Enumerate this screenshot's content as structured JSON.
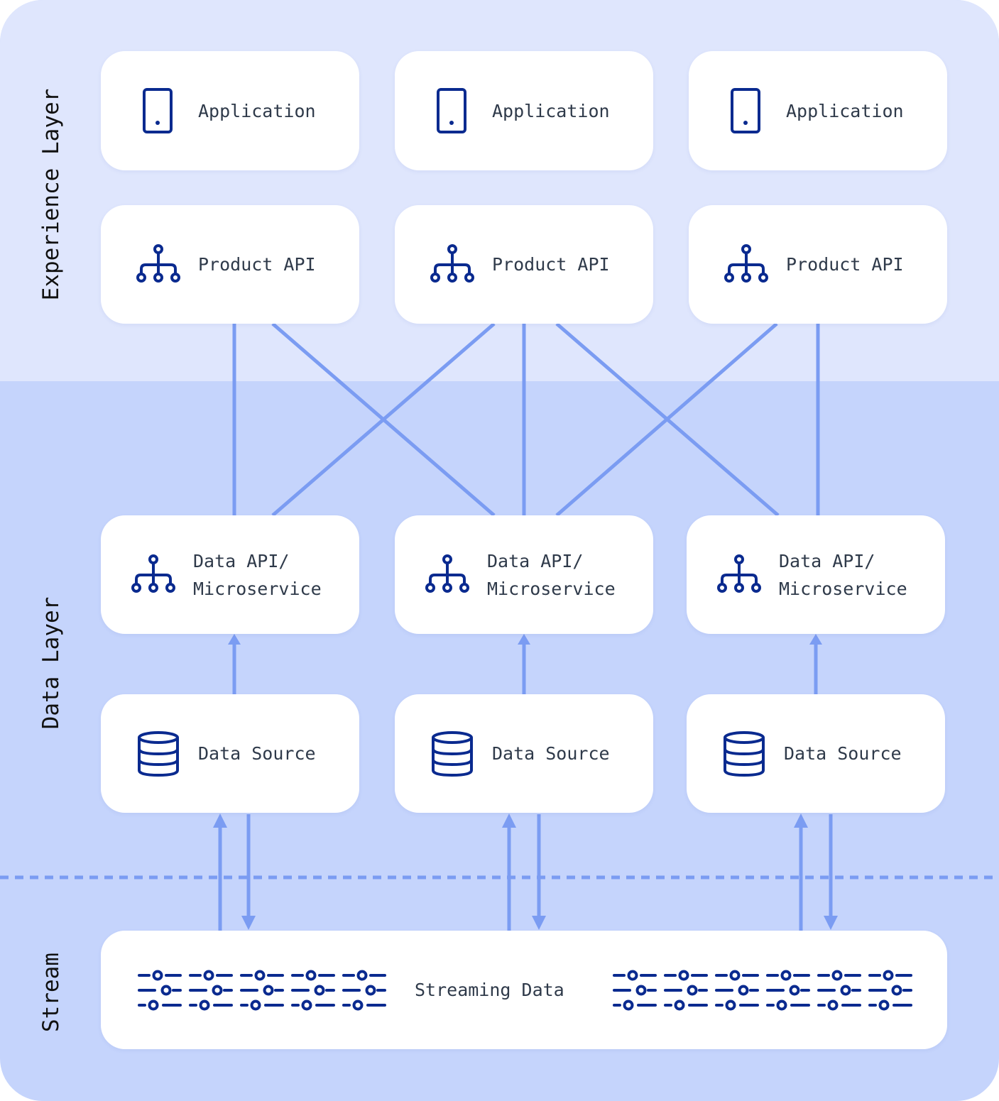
{
  "layers": {
    "experience": "Experience Layer",
    "data": "Data Layer",
    "stream": "Stream"
  },
  "applications": [
    {
      "label": "Application",
      "icon": "tablet-icon"
    },
    {
      "label": "Application",
      "icon": "tablet-icon"
    },
    {
      "label": "Application",
      "icon": "tablet-icon"
    }
  ],
  "product_apis": [
    {
      "label": "Product API",
      "icon": "hierarchy-icon"
    },
    {
      "label": "Product API",
      "icon": "hierarchy-icon"
    },
    {
      "label": "Product API",
      "icon": "hierarchy-icon"
    }
  ],
  "data_apis": [
    {
      "label": "Data API/\nMicroservice",
      "icon": "hierarchy-icon"
    },
    {
      "label": "Data API/\nMicroservice",
      "icon": "hierarchy-icon"
    },
    {
      "label": "Data API/\nMicroservice",
      "icon": "hierarchy-icon"
    }
  ],
  "data_sources": [
    {
      "label": "Data Source",
      "icon": "database-icon"
    },
    {
      "label": "Data Source",
      "icon": "database-icon"
    },
    {
      "label": "Data Source",
      "icon": "database-icon"
    }
  ],
  "stream": {
    "label": "Streaming Data",
    "icon": "sliders-icon"
  },
  "colors": {
    "experience_bg": "#dfe6fd",
    "data_bg": "#c5d4fc",
    "connector": "#7b9cf2",
    "icon": "#0a2a8f",
    "text": "#2f3a4a"
  }
}
